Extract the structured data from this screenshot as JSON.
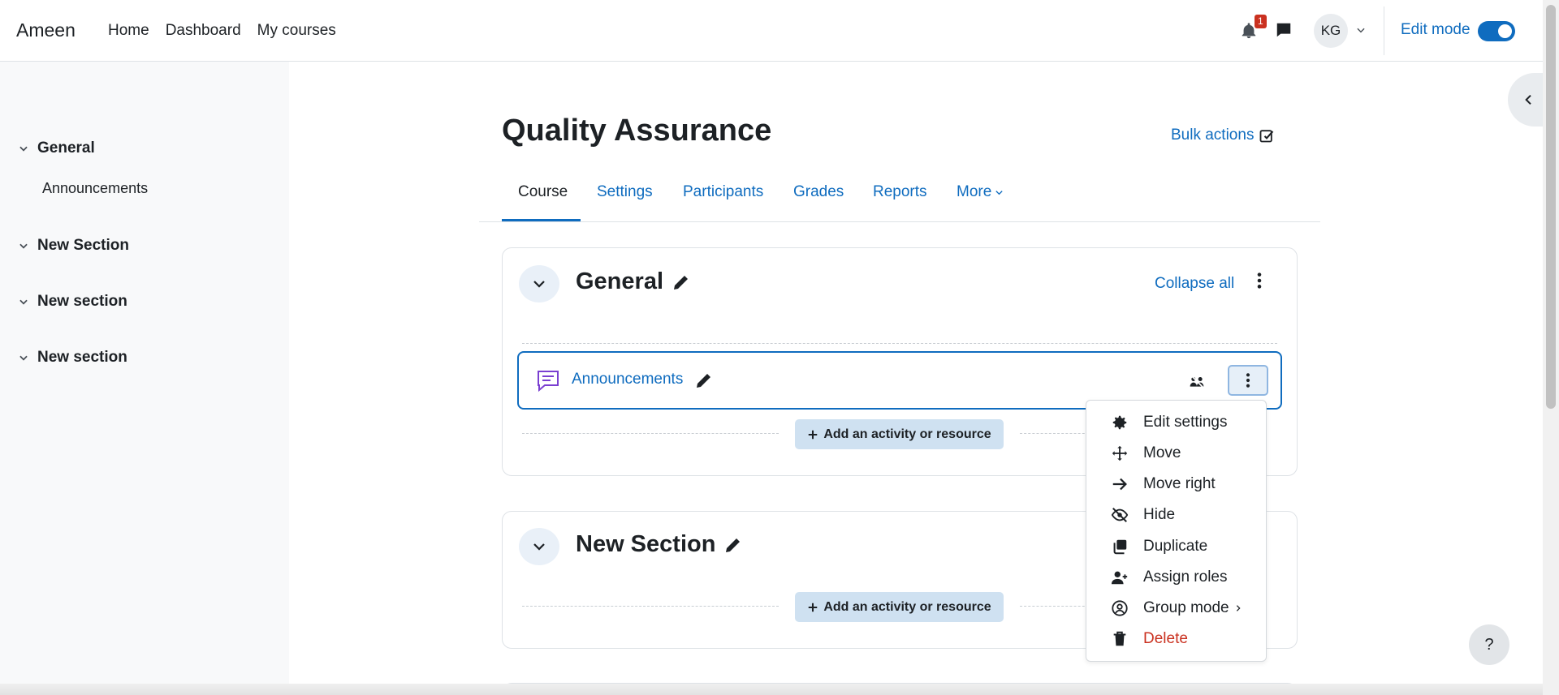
{
  "navbar": {
    "brand": "Ameen",
    "links": [
      "Home",
      "Dashboard",
      "My courses"
    ],
    "notification_count": "1",
    "user_initials": "KG",
    "edit_mode_label": "Edit mode",
    "edit_mode_on": true
  },
  "sidebar": {
    "sections": [
      {
        "label": "General",
        "items": [
          "Announcements"
        ]
      },
      {
        "label": "New Section",
        "items": []
      },
      {
        "label": "New section",
        "items": []
      },
      {
        "label": "New section",
        "items": []
      }
    ]
  },
  "course": {
    "title": "Quality Assurance",
    "bulk_actions": "Bulk actions",
    "tabs": [
      "Course",
      "Settings",
      "Participants",
      "Grades",
      "Reports",
      "More"
    ],
    "active_tab": "Course"
  },
  "sections": [
    {
      "title": "General",
      "collapse_all": "Collapse all",
      "activity": {
        "name": "Announcements"
      },
      "add_label": "Add an activity or resource"
    },
    {
      "title": "New Section",
      "add_label": "Add an activity or resource"
    }
  ],
  "dropdown": {
    "items": [
      {
        "label": "Edit settings",
        "icon": "gear-icon"
      },
      {
        "label": "Move",
        "icon": "move-icon"
      },
      {
        "label": "Move right",
        "icon": "arrow-right-icon"
      },
      {
        "label": "Hide",
        "icon": "eye-slash-icon"
      },
      {
        "label": "Duplicate",
        "icon": "copy-icon"
      },
      {
        "label": "Assign roles",
        "icon": "user-plus-icon"
      },
      {
        "label": "Group mode",
        "icon": "user-circle-icon"
      },
      {
        "label": "Delete",
        "icon": "trash-icon"
      }
    ]
  },
  "help_label": "?",
  "colors": {
    "accent": "#0f6cbf",
    "danger": "#ca3120",
    "sidebar_bg": "#f8f9fa"
  }
}
